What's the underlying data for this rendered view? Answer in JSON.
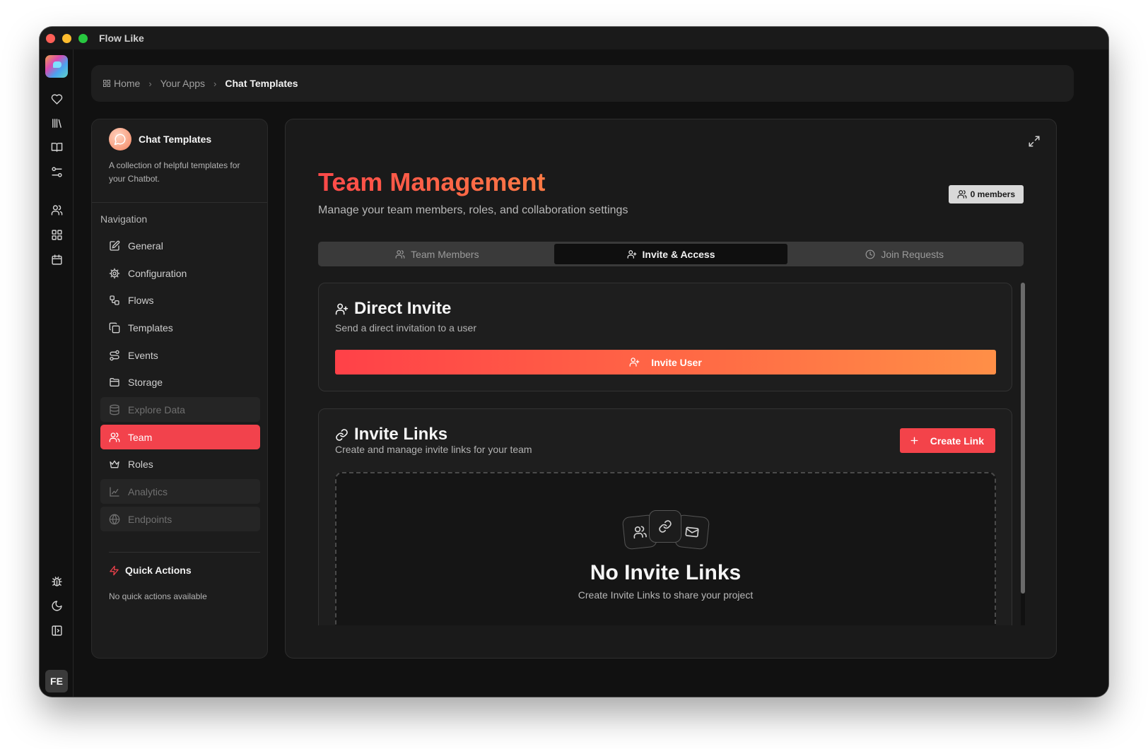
{
  "window": {
    "title": "Flow Like"
  },
  "rail": {
    "top_icons": [
      "heart-icon",
      "library-icon",
      "book-icon",
      "sliders-icon",
      "users-icon",
      "grid-icon",
      "calendar-icon"
    ],
    "bottom_icons": [
      "bug-icon",
      "moon-icon",
      "panel-icon"
    ],
    "user_initials": "FE"
  },
  "breadcrumb": {
    "items": [
      {
        "label": "Home",
        "icon": "grid-icon"
      },
      {
        "label": "Your Apps"
      },
      {
        "label": "Chat Templates"
      }
    ]
  },
  "sidebar": {
    "app_name": "Chat Templates",
    "app_description": "A collection of helpful templates for your Chatbot.",
    "nav_title": "Navigation",
    "items": [
      {
        "label": "General",
        "icon": "edit-icon",
        "state": "normal"
      },
      {
        "label": "Configuration",
        "icon": "cog-icon",
        "state": "normal"
      },
      {
        "label": "Flows",
        "icon": "workflow-icon",
        "state": "normal"
      },
      {
        "label": "Templates",
        "icon": "copy-icon",
        "state": "normal"
      },
      {
        "label": "Events",
        "icon": "route-icon",
        "state": "normal"
      },
      {
        "label": "Storage",
        "icon": "folder-icon",
        "state": "normal"
      },
      {
        "label": "Explore Data",
        "icon": "database-icon",
        "state": "disabled"
      },
      {
        "label": "Team",
        "icon": "users-icon",
        "state": "active"
      },
      {
        "label": "Roles",
        "icon": "crown-icon",
        "state": "normal"
      },
      {
        "label": "Analytics",
        "icon": "chart-icon",
        "state": "disabled"
      },
      {
        "label": "Endpoints",
        "icon": "globe-icon",
        "state": "disabled"
      }
    ],
    "quick_actions_title": "Quick Actions",
    "quick_actions_empty": "No quick actions available"
  },
  "main": {
    "title": "Team Management",
    "subtitle": "Manage your team members, roles, and collaboration settings",
    "members_badge": "0 members",
    "tabs": [
      {
        "label": "Team Members",
        "active": false
      },
      {
        "label": "Invite & Access",
        "active": true
      },
      {
        "label": "Join Requests",
        "active": false
      }
    ],
    "direct_invite": {
      "title": "Direct Invite",
      "subtitle": "Send a direct invitation to a user",
      "button": "Invite User"
    },
    "invite_links": {
      "title": "Invite Links",
      "subtitle": "Create and manage invite links for your team",
      "button": "Create Link",
      "empty_title": "No Invite Links",
      "empty_subtitle": "Create Invite Links to share your project"
    }
  },
  "colors": {
    "accent": "#f2424c",
    "gradient_start": "#ff4148",
    "gradient_end": "#ff8f47",
    "background": "#111111"
  }
}
